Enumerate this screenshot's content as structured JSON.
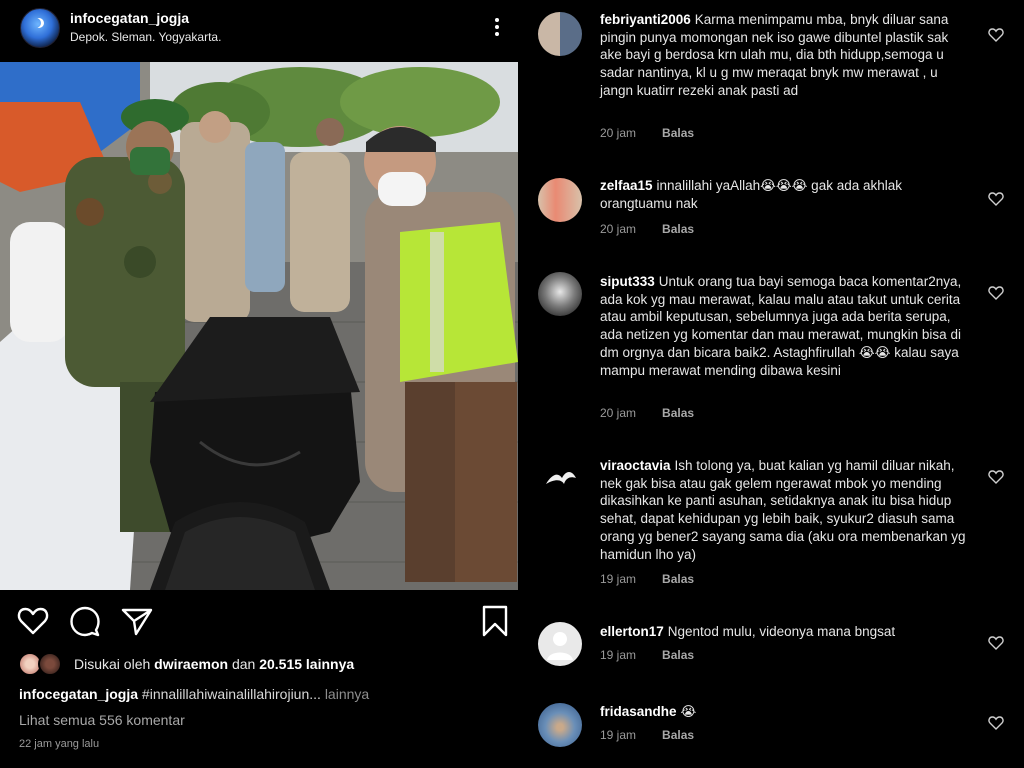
{
  "post": {
    "username": "infocegatan_jogja",
    "location": "Depok. Sleman. Yogyakarta.",
    "likes_prefix": "Disukai oleh",
    "liked_by_user": "dwiraemon",
    "likes_mid": "dan",
    "likes_count": "20.515 lainnya",
    "caption_user": "infocegatan_jogja",
    "caption_text": "#innalillahiwainalillahirojiun...",
    "caption_more": "lainnya",
    "view_all_comments": "Lihat semua 556 komentar",
    "time": "22 jam yang lalu"
  },
  "icons": {
    "more": "more-vertical-icon",
    "like": "heart-icon",
    "comment": "comment-icon",
    "share": "send-icon",
    "save": "bookmark-icon"
  },
  "comments": [
    {
      "username": "febriyanti2006",
      "text": "Karma menimpamu mba, bnyk diluar sana pingin punya momongan nek iso gawe dibuntel plastik sak ake bayi g berdosa krn ulah mu, dia bth hidupp,semoga u sadar nantinya, kl u g mw meraqat bnyk mw merawat , u jangn kuatirr rezeki anak pasti ad",
      "time": "20 jam",
      "reply": "Balas"
    },
    {
      "username": "zelfaa15",
      "text": "innalillahi yaAllah😭😭😭 gak ada akhlak orangtuamu nak",
      "time": "20 jam",
      "reply": "Balas"
    },
    {
      "username": "siput333",
      "text": "Untuk orang tua bayi semoga baca komentar2nya, ada kok yg mau merawat, kalau malu atau takut untuk cerita atau ambil keputusan, sebelumnya juga ada berita serupa, ada netizen yg komentar dan mau merawat, mungkin bisa di dm orgnya dan bicara baik2. Astaghfirullah 😭😭 kalau saya mampu merawat mending dibawa kesini",
      "time": "20 jam",
      "reply": "Balas"
    },
    {
      "username": "viraoctavia",
      "text": "Ish tolong ya, buat kalian yg hamil diluar nikah, nek gak bisa atau gak gelem ngerawat mbok yo mending dikasihkan ke panti asuhan, setidaknya anak itu bisa hidup sehat, dapat kehidupan yg lebih baik, syukur2 diasuh sama orang yg bener2 sayang sama dia (aku ora membenarkan yg hamidun lho ya)",
      "time": "19 jam",
      "reply": "Balas"
    },
    {
      "username": "ellerton17",
      "text": "Ngentod mulu, videonya mana bngsat",
      "time": "19 jam",
      "reply": "Balas"
    },
    {
      "username": "fridasandhe",
      "text": "😭",
      "time": "19 jam",
      "reply": "Balas"
    }
  ],
  "colors": {
    "background": "#000000",
    "text": "#f5f5f5",
    "muted": "#9a9a9a",
    "uniform_green": "#b7e637"
  }
}
